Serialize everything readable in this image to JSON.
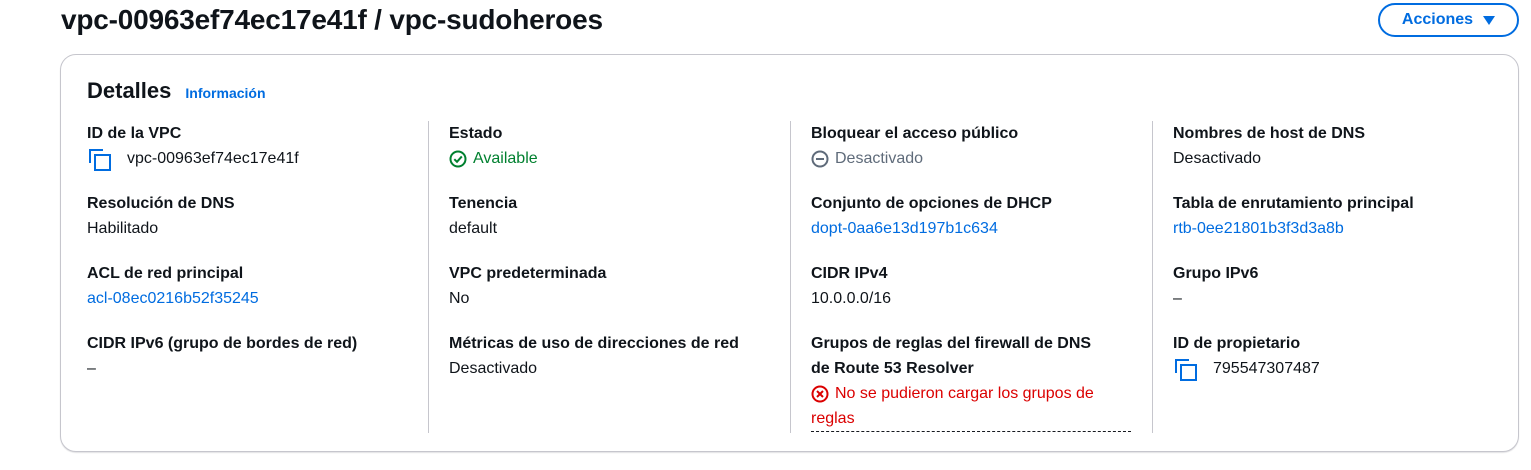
{
  "header": {
    "title": "vpc-00963ef74ec17e41f / vpc-sudoheroes",
    "actions_label": "Acciones"
  },
  "card": {
    "title": "Detalles",
    "info_link": "Información"
  },
  "details": {
    "col1": [
      {
        "label": "ID de la VPC",
        "value": "vpc-00963ef74ec17e41f"
      },
      {
        "label": "Resolución de DNS",
        "value": "Habilitado"
      },
      {
        "label": "ACL de red principal",
        "value": "acl-08ec0216b52f35245"
      },
      {
        "label": "CIDR IPv6 (grupo de bordes de red)",
        "value": "–"
      }
    ],
    "col2": [
      {
        "label": "Estado",
        "value": "Available"
      },
      {
        "label": "Tenencia",
        "value": "default"
      },
      {
        "label": "VPC predeterminada",
        "value": "No"
      },
      {
        "label": "Métricas de uso de direcciones de red",
        "value": "Desactivado"
      }
    ],
    "col3": [
      {
        "label": "Bloquear el acceso público",
        "value": "Desactivado"
      },
      {
        "label": "Conjunto de opciones de DHCP",
        "value": "dopt-0aa6e13d197b1c634"
      },
      {
        "label": "CIDR IPv4",
        "value": "10.0.0.0/16"
      },
      {
        "label_line1": "Grupos de reglas del firewall de DNS",
        "label_line2": "de Route 53 Resolver",
        "value_line1": "No se pudieron cargar los grupos de",
        "value_line2": "reglas"
      }
    ],
    "col4": [
      {
        "label": "Nombres de host de DNS",
        "value": "Desactivado"
      },
      {
        "label": "Tabla de enrutamiento principal",
        "value": "rtb-0ee21801b3f3d3a8b"
      },
      {
        "label": "Grupo IPv6",
        "value": "–"
      },
      {
        "label": "ID de propietario",
        "value": "795547307487"
      }
    ]
  },
  "colors": {
    "link": "#006ce0",
    "success": "#00802f",
    "error": "#db0000",
    "muted": "#5f6b7a"
  }
}
